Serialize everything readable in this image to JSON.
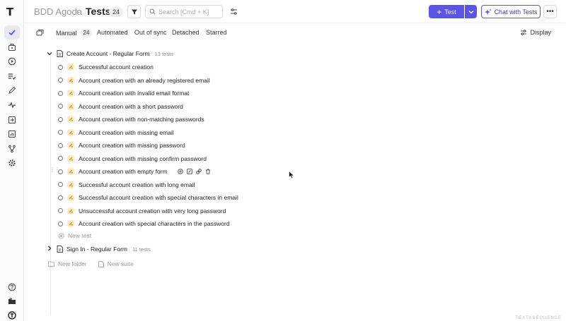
{
  "rail": {
    "logo_text": "T",
    "items": [
      {
        "icon": "check-icon",
        "active": true
      },
      {
        "icon": "briefcase-icon",
        "active": false
      },
      {
        "icon": "play-circle-icon",
        "active": false
      },
      {
        "icon": "list-check-icon",
        "active": false
      },
      {
        "icon": "pen-icon",
        "active": false
      },
      {
        "icon": "pulse-icon",
        "active": false
      },
      {
        "icon": "import-icon",
        "active": false
      },
      {
        "icon": "chart-icon",
        "active": false
      },
      {
        "icon": "branch-icon",
        "active": false
      },
      {
        "icon": "gear-icon",
        "active": false
      }
    ],
    "bottom": [
      {
        "icon": "help-icon"
      },
      {
        "icon": "folder-icon"
      },
      {
        "icon": "account-icon"
      }
    ]
  },
  "header": {
    "project": "BDD Agoda",
    "separator": "›",
    "title": "Tests",
    "count": "24",
    "search_placeholder": "Search [Cmd + K]",
    "test_button": "Test",
    "chat_button": "Chat with Tests",
    "more_label": "•••",
    "accent_color": "#5b54e8"
  },
  "tabs": {
    "items": [
      {
        "label": "Manual",
        "count": "24"
      },
      {
        "label": "Automated",
        "count": ""
      },
      {
        "label": "Out of sync",
        "count": ""
      },
      {
        "label": "Detached",
        "count": ""
      },
      {
        "label": "Starred",
        "count": ""
      }
    ],
    "display_label": "Display"
  },
  "tree": {
    "suites": [
      {
        "name": "Create Account - Regular Form",
        "meta": "13 tests",
        "expanded": true,
        "tests": [
          "Successful account creation",
          "Account creation with an already registered email",
          "Account creation with invalid email format",
          "Account creation with a short password",
          "Account creation with non-matching passwords",
          "Account creation with missing email",
          "Account creation with missing password",
          "Account creation with missing confirm password",
          "Account creation with empty form",
          "Successful account creation with long email",
          "Successful account creation with special characters in email",
          "Unsuccessful account creation with very long password",
          "Account creation with special characters in the password"
        ],
        "new_test_label": "New test"
      },
      {
        "name": "Sign In - Regular Form",
        "meta": "11 tests",
        "expanded": false
      }
    ],
    "new_folder_label": "New folder",
    "new_suite_label": "New suite"
  },
  "corner_text": "TEXTASEQUENCE"
}
